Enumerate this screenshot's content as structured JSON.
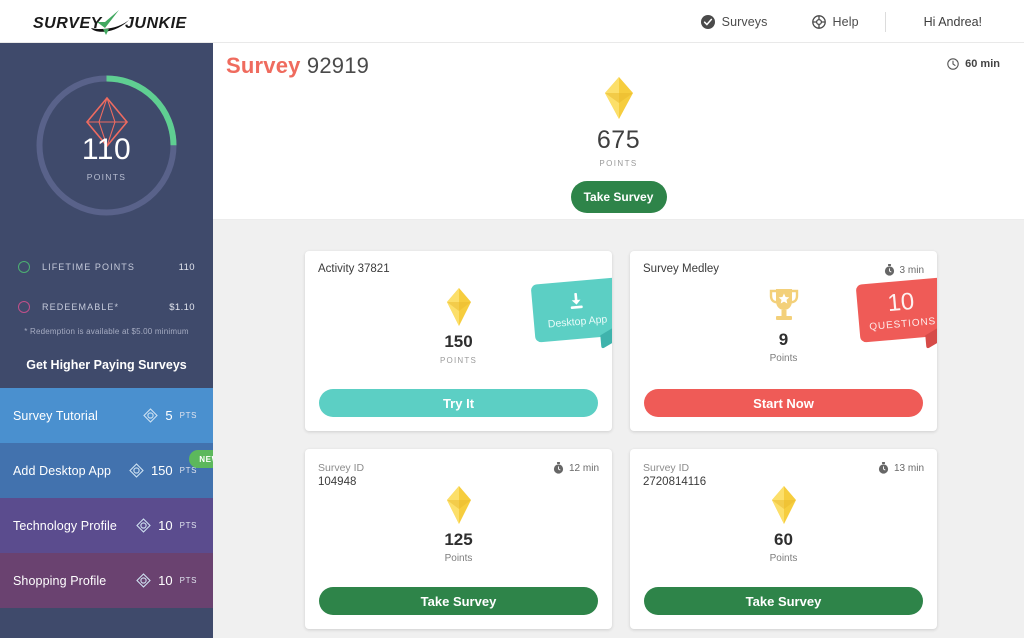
{
  "colors": {
    "sidebar_bg": "#3f4a6b",
    "accent_coral": "#ef6b5e",
    "green": "#2e8449",
    "teal": "#5ccfc4",
    "red": "#ef5b57",
    "gold": "#f5cc3f"
  },
  "header": {
    "logo_text": "SURVEY JUNKIE",
    "nav": [
      {
        "icon": "check-circle-icon",
        "label": "Surveys"
      },
      {
        "icon": "lifebuoy-icon",
        "label": "Help"
      }
    ],
    "greeting": "Hi Andrea!"
  },
  "sidebar": {
    "ring": {
      "points": "110",
      "label": "POINTS",
      "percent": 25,
      "icon": "diamond-icon"
    },
    "stats": [
      {
        "icon": "circle-green-icon",
        "label": "LIFETIME POINTS",
        "value": "110"
      },
      {
        "icon": "circle-pink-icon",
        "label": "REDEEMABLE*",
        "value": "$1.10"
      }
    ],
    "note": "* Redemption is available at $5.00 minimum",
    "higher_paying_link": "Get Higher Paying Surveys",
    "items": [
      {
        "label": "Survey Tutorial",
        "points": "5",
        "unit": "PTS",
        "color": "#4a90cf",
        "badge": null
      },
      {
        "label": "Add Desktop App",
        "points": "150",
        "unit": "PTS",
        "color": "#4272ae",
        "badge": "NEW!"
      },
      {
        "label": "Technology Profile",
        "points": "10",
        "unit": "PTS",
        "color": "#5b4c8e",
        "badge": null
      },
      {
        "label": "Shopping Profile",
        "points": "10",
        "unit": "PTS",
        "color": "#6a4270",
        "badge": null
      }
    ]
  },
  "hero": {
    "title_accent": "Survey",
    "title_id": "92919",
    "time_icon": "clock-icon",
    "time": "60 min",
    "icon": "diamond-icon",
    "points": "675",
    "points_label": "POINTS",
    "button": "Take Survey"
  },
  "cards": [
    {
      "title_single": "Activity 37821",
      "time": null,
      "icon": "diamond-icon",
      "amount": "150",
      "unit": "POINTS",
      "unit_caps": true,
      "button": "Try It",
      "button_color": "teal",
      "ribbon": {
        "style": "teal",
        "icon": "download-icon",
        "text": "Desktop App"
      }
    },
    {
      "title_single": "Survey Medley",
      "time_icon": "stopwatch-icon",
      "time": "3 min",
      "icon": "trophy-icon",
      "amount": "9",
      "unit": "Points",
      "unit_caps": false,
      "button": "Start Now",
      "button_color": "red",
      "ribbon": {
        "style": "red",
        "number": "10",
        "text": "QUESTIONS"
      }
    },
    {
      "title_key": "Survey ID",
      "title_value": "104948",
      "time_icon": "stopwatch-icon",
      "time": "12 min",
      "icon": "diamond-icon",
      "amount": "125",
      "unit": "Points",
      "unit_caps": false,
      "button": "Take Survey",
      "button_color": "green",
      "ribbon": null
    },
    {
      "title_key": "Survey ID",
      "title_value": "2720814116",
      "time_icon": "stopwatch-icon",
      "time": "13 min",
      "icon": "diamond-icon",
      "amount": "60",
      "unit": "Points",
      "unit_caps": false,
      "button": "Take Survey",
      "button_color": "green",
      "ribbon": null
    }
  ]
}
